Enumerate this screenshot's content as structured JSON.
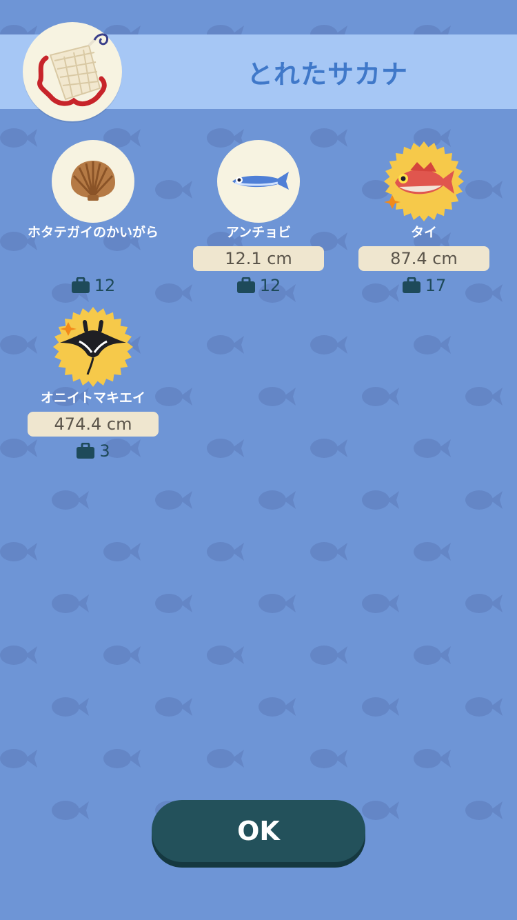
{
  "header": {
    "title": "とれたサカナ",
    "tool_icon": "net-icon"
  },
  "items": [
    {
      "name": "ホタテガイのかいがら",
      "size": "",
      "bag_count": "12",
      "icon": "scallop-shell-icon",
      "rare": false
    },
    {
      "name": "アンチョビ",
      "size": "12.1 cm",
      "bag_count": "12",
      "icon": "anchovy-icon",
      "rare": false
    },
    {
      "name": "タイ",
      "size": "87.4 cm",
      "bag_count": "17",
      "icon": "sea-bream-icon",
      "rare": true
    },
    {
      "name": "オニイトマキエイ",
      "size": "474.4 cm",
      "bag_count": "3",
      "icon": "manta-ray-icon",
      "rare": true
    }
  ],
  "footer": {
    "ok_label": "OK"
  },
  "colors": {
    "background": "#6e95d6",
    "header_band": "#a6c7f5",
    "title": "#3f78c9",
    "button": "#23515b",
    "badge_cream": "#f7f3e1",
    "rare_gold": "#f6c94a"
  }
}
